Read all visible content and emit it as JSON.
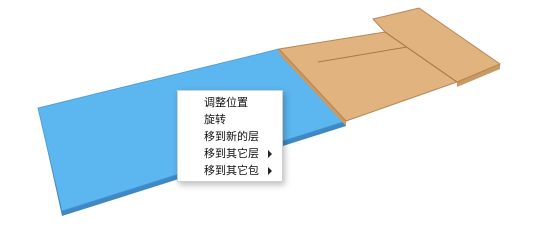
{
  "scene": {
    "colors": {
      "background": "#ffffff",
      "blue_sheet": "#5cb6ef",
      "blue_edge": "#4a97cf",
      "blue_side": "#3f88c6",
      "wood_panel": "#e0b37f",
      "wood_edge": "#b68555",
      "wood_side": "#c99a63"
    }
  },
  "context_menu": {
    "items": [
      {
        "label": "调整位置",
        "has_submenu": false
      },
      {
        "label": "旋转",
        "has_submenu": false
      },
      {
        "label": "移到新的层",
        "has_submenu": false
      },
      {
        "label": "移到其它层",
        "has_submenu": true
      },
      {
        "label": "移到其它包",
        "has_submenu": true
      }
    ]
  }
}
